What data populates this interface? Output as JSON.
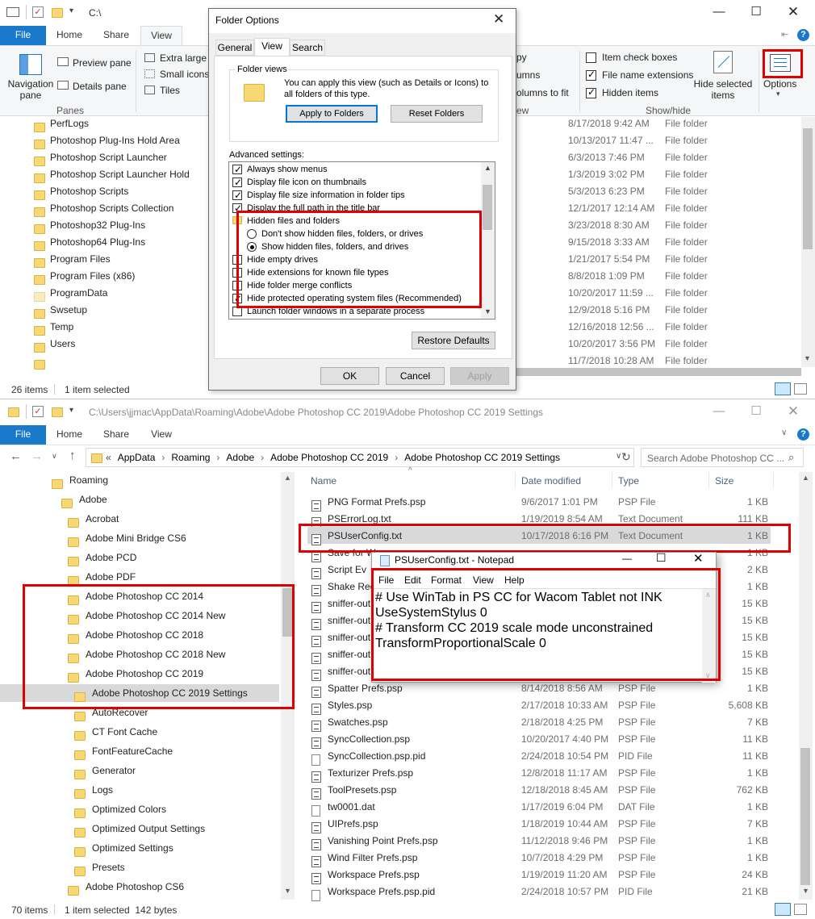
{
  "top_window": {
    "title": "C:\\",
    "tabs": {
      "file": "File",
      "home": "Home",
      "share": "Share",
      "view": "View"
    },
    "ribbon": {
      "navigation_pane": "Navigation pane",
      "preview_pane": "Preview pane",
      "details_pane": "Details pane",
      "panes_group": "Panes",
      "extra_large": "Extra large i",
      "small_icons": "Small icons",
      "tiles": "Tiles",
      "layout_frag1": "py",
      "layout_frag2": "umns",
      "layout_frag3": "olumns to fit",
      "layout_frag4": "ew",
      "item_check_boxes": "Item check boxes",
      "file_name_extensions": "File name extensions",
      "hidden_items": "Hidden items",
      "hide_selected": "Hide selected items",
      "options": "Options",
      "show_hide_group": "Show/hide"
    },
    "rows": [
      {
        "name": "PerfLogs",
        "date": "8/17/2018 9:42 AM",
        "type": "File folder"
      },
      {
        "name": "Photoshop  Plug-Ins Hold Area",
        "date": "10/13/2017 11:47 ...",
        "type": "File folder"
      },
      {
        "name": "Photoshop Script Launcher",
        "date": "6/3/2013 7:46 PM",
        "type": "File folder"
      },
      {
        "name": "Photoshop Script Launcher Hold",
        "date": "1/3/2019 3:02 PM",
        "type": "File folder"
      },
      {
        "name": "Photoshop Scripts",
        "date": "5/3/2013 6:23 PM",
        "type": "File folder"
      },
      {
        "name": "Photoshop Scripts Collection",
        "date": "12/1/2017 12:14 AM",
        "type": "File folder"
      },
      {
        "name": "Photoshop32 Plug-Ins",
        "date": "3/23/2018 8:30 AM",
        "type": "File folder"
      },
      {
        "name": "Photoshop64 Plug-Ins",
        "date": "9/15/2018 3:33 AM",
        "type": "File folder"
      },
      {
        "name": "Program Files",
        "date": "1/21/2017 5:54 PM",
        "type": "File folder"
      },
      {
        "name": "Program Files (x86)",
        "date": "8/8/2018 1:09 PM",
        "type": "File folder"
      },
      {
        "name": "ProgramData",
        "date": "10/20/2017 11:59 ...",
        "type": "File folder"
      },
      {
        "name": "Swsetup",
        "date": "12/9/2018 5:16 PM",
        "type": "File folder"
      },
      {
        "name": "Temp",
        "date": "12/16/2018 12:56 ...",
        "type": "File folder"
      },
      {
        "name": "Users",
        "date": "10/20/2017 3:56 PM",
        "type": "File folder"
      },
      {
        "name": "",
        "date": "11/7/2018 10:28 AM",
        "type": "File folder"
      }
    ],
    "status_count": "26 items",
    "status_selected": "1 item selected"
  },
  "folder_options": {
    "title": "Folder Options",
    "tabs": {
      "general": "General",
      "view": "View",
      "search": "Search"
    },
    "folder_views_label": "Folder views",
    "folder_views_desc": "You can apply this view (such as Details or Icons) to all folders of this type.",
    "apply_to_folders": "Apply to Folders",
    "reset_folders": "Reset Folders",
    "advanced_label": "Advanced settings:",
    "advanced": [
      {
        "label": "Always show menus",
        "kind": "checkbox",
        "checked": true
      },
      {
        "label": "Display file icon on thumbnails",
        "kind": "checkbox",
        "checked": true
      },
      {
        "label": "Display file size information in folder tips",
        "kind": "checkbox",
        "checked": true
      },
      {
        "label": "Display the full path in the title bar",
        "kind": "checkbox",
        "checked": true
      },
      {
        "label": "Hidden files and folders",
        "kind": "folder"
      },
      {
        "label": "Don't show hidden files, folders, or drives",
        "kind": "radio",
        "checked": false
      },
      {
        "label": "Show hidden files, folders, and drives",
        "kind": "radio",
        "checked": true
      },
      {
        "label": "Hide empty drives",
        "kind": "checkbox",
        "checked": false
      },
      {
        "label": "Hide extensions for known file types",
        "kind": "checkbox",
        "checked": false
      },
      {
        "label": "Hide folder merge conflicts",
        "kind": "checkbox",
        "checked": false
      },
      {
        "label": "Hide protected operating system files (Recommended)",
        "kind": "checkbox",
        "checked": true
      },
      {
        "label": "Launch folder windows in a separate process",
        "kind": "checkbox",
        "checked": false
      }
    ],
    "restore_defaults": "Restore Defaults",
    "ok": "OK",
    "cancel": "Cancel",
    "apply": "Apply"
  },
  "bottom_window": {
    "title": "C:\\Users\\jjmac\\AppData\\Roaming\\Adobe\\Adobe Photoshop CC 2019\\Adobe Photoshop CC 2019 Settings",
    "tabs": {
      "file": "File",
      "home": "Home",
      "share": "Share",
      "view": "View"
    },
    "breadcrumb": {
      "overflow": "«",
      "items": [
        "AppData",
        "Roaming",
        "Adobe",
        "Adobe Photoshop CC 2019",
        "Adobe Photoshop CC 2019 Settings"
      ]
    },
    "search_placeholder": "Search Adobe Photoshop CC ...",
    "nav_tree": [
      {
        "label": "Roaming",
        "indent": 0
      },
      {
        "label": "Adobe",
        "indent": 1
      },
      {
        "label": "Acrobat",
        "indent": 2
      },
      {
        "label": "Adobe Mini Bridge CS6",
        "indent": 2
      },
      {
        "label": "Adobe PCD",
        "indent": 2
      },
      {
        "label": "Adobe PDF",
        "indent": 2
      },
      {
        "label": "Adobe Photoshop CC 2014",
        "indent": 2
      },
      {
        "label": "Adobe Photoshop CC 2014 New",
        "indent": 2
      },
      {
        "label": "Adobe Photoshop CC 2018",
        "indent": 2
      },
      {
        "label": "Adobe Photoshop CC 2018 New",
        "indent": 2
      },
      {
        "label": "Adobe Photoshop CC 2019",
        "indent": 2
      },
      {
        "label": "Adobe Photoshop CC 2019 Settings",
        "indent": 3,
        "selected": true
      },
      {
        "label": "AutoRecover",
        "indent": 3
      },
      {
        "label": "CT Font Cache",
        "indent": 3
      },
      {
        "label": "FontFeatureCache",
        "indent": 3
      },
      {
        "label": "Generator",
        "indent": 3
      },
      {
        "label": "Logs",
        "indent": 3
      },
      {
        "label": "Optimized Colors",
        "indent": 3
      },
      {
        "label": "Optimized Output Settings",
        "indent": 3
      },
      {
        "label": "Optimized Settings",
        "indent": 3
      },
      {
        "label": "Presets",
        "indent": 3
      },
      {
        "label": "Adobe Photoshop CS6",
        "indent": 2
      }
    ],
    "columns": {
      "name": "Name",
      "date": "Date modified",
      "type": "Type",
      "size": "Size"
    },
    "files": [
      {
        "name": "PNG Format Prefs.psp",
        "date": "9/6/2017 1:01 PM",
        "type": "PSP File",
        "size": "1 KB",
        "icon": "psp"
      },
      {
        "name": "PSErrorLog.txt",
        "date": "1/19/2019 8:54 AM",
        "type": "Text Document",
        "size": "111 KB",
        "icon": "txt"
      },
      {
        "name": "PSUserConfig.txt",
        "date": "10/17/2018 6:16 PM",
        "type": "Text Document",
        "size": "1 KB",
        "icon": "txt",
        "selected": true
      },
      {
        "name": "Save for W",
        "date": "",
        "type": "",
        "size": "1 KB",
        "icon": "psp"
      },
      {
        "name": "Script Ev",
        "date": "",
        "type": "",
        "size": "2 KB",
        "icon": "psp"
      },
      {
        "name": "Shake Red",
        "date": "",
        "type": "",
        "size": "1 KB",
        "icon": "psp"
      },
      {
        "name": "sniffer-out",
        "date": "",
        "type": "",
        "size": "15 KB",
        "icon": "txt"
      },
      {
        "name": "sniffer-out",
        "date": "",
        "type": "",
        "size": "15 KB",
        "icon": "txt"
      },
      {
        "name": "sniffer-out",
        "date": "",
        "type": "",
        "size": "15 KB",
        "icon": "txt"
      },
      {
        "name": "sniffer-out",
        "date": "",
        "type": "",
        "size": "15 KB",
        "icon": "txt"
      },
      {
        "name": "sniffer-out",
        "date": "",
        "type": "",
        "size": "15 KB",
        "icon": "txt"
      },
      {
        "name": "Spatter Prefs.psp",
        "date": "8/14/2018 8:56 AM",
        "type": "PSP File",
        "size": "1 KB",
        "icon": "psp"
      },
      {
        "name": "Styles.psp",
        "date": "2/17/2018 10:33 AM",
        "type": "PSP File",
        "size": "5,608 KB",
        "icon": "psp"
      },
      {
        "name": "Swatches.psp",
        "date": "2/18/2018 4:25 PM",
        "type": "PSP File",
        "size": "7 KB",
        "icon": "psp"
      },
      {
        "name": "SyncCollection.psp",
        "date": "10/20/2017 4:40 PM",
        "type": "PSP File",
        "size": "11 KB",
        "icon": "psp"
      },
      {
        "name": "SyncCollection.psp.pid",
        "date": "2/24/2018 10:54 PM",
        "type": "PID File",
        "size": "11 KB",
        "icon": "blank"
      },
      {
        "name": "Texturizer Prefs.psp",
        "date": "12/8/2018 11:17 AM",
        "type": "PSP File",
        "size": "1 KB",
        "icon": "psp"
      },
      {
        "name": "ToolPresets.psp",
        "date": "12/18/2018 8:45 AM",
        "type": "PSP File",
        "size": "762 KB",
        "icon": "psp"
      },
      {
        "name": "tw0001.dat",
        "date": "1/17/2019 6:04 PM",
        "type": "DAT File",
        "size": "1 KB",
        "icon": "blank"
      },
      {
        "name": "UIPrefs.psp",
        "date": "1/18/2019 10:44 AM",
        "type": "PSP File",
        "size": "7 KB",
        "icon": "psp"
      },
      {
        "name": "Vanishing Point Prefs.psp",
        "date": "11/12/2018 9:46 PM",
        "type": "PSP File",
        "size": "1 KB",
        "icon": "psp"
      },
      {
        "name": "Wind Filter Prefs.psp",
        "date": "10/7/2018 4:29 PM",
        "type": "PSP File",
        "size": "1 KB",
        "icon": "psp"
      },
      {
        "name": "Workspace Prefs.psp",
        "date": "1/19/2019 11:20 AM",
        "type": "PSP File",
        "size": "24 KB",
        "icon": "psp"
      },
      {
        "name": "Workspace Prefs.psp.pid",
        "date": "2/24/2018 10:57 PM",
        "type": "PID File",
        "size": "21 KB",
        "icon": "blank"
      }
    ],
    "status_count": "70 items",
    "status_selected": "1 item selected  142 bytes"
  },
  "notepad": {
    "title": "PSUserConfig.txt - Notepad",
    "menu": [
      "File",
      "Edit",
      "Format",
      "View",
      "Help"
    ],
    "lines": [
      "# Use WinTab in PS CC for Wacom Tablet not INK",
      "UseSystemStylus 0",
      "# Transform CC 2019 scale mode unconstrained",
      "TransformProportionalScale 0"
    ]
  },
  "colors": {
    "accent": "#1979ca",
    "highlight": "#e00000",
    "selection": "#cce8ff"
  }
}
